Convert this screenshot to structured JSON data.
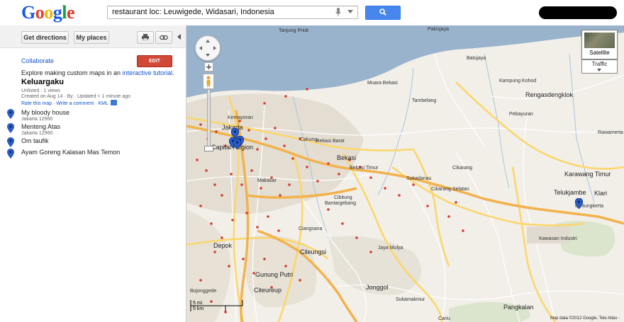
{
  "header": {
    "logo": [
      "G",
      "o",
      "o",
      "g",
      "l",
      "e"
    ],
    "logo_colors": [
      "#1a5ae6",
      "#e33b2f",
      "#f2b600",
      "#1a5ae6",
      "#139c44",
      "#e33b2f"
    ],
    "search_value": "restaurant loc: Leuwigede, Widasari, Indonesia",
    "search_icon": "magnifier-icon"
  },
  "panel": {
    "get_directions": "Get directions",
    "my_places": "My places",
    "collaborate": "Collaborate",
    "edit": "EDIT",
    "explore_prefix": "Explore making custom maps in an ",
    "explore_link": "interactive tutorial",
    "explore_suffix": ".",
    "title": "Keluargaku",
    "meta_line1": "Unlisted · 1 views",
    "meta_line2_prefix": "Created on Aug 14 · By ",
    "meta_line2_suffix": " · Updated < 1 minute ago",
    "rate": "Rate this map",
    "write_comment": "Write a comment",
    "kml": "KML",
    "places": [
      {
        "name": "My bloody house",
        "address": "Jakarta 12960"
      },
      {
        "name": "Menteng Atas",
        "address": "Jakarta 12960"
      },
      {
        "name": "Om taufik",
        "address": ""
      },
      {
        "name": "Ayam Goreng Kalasan Mas Temon",
        "address": ""
      }
    ]
  },
  "map": {
    "controls": {
      "satellite": "Satellite",
      "traffic": "Traffic",
      "zoom_plus": "+"
    },
    "scale_mi": "5 mi",
    "scale_km": "5 km",
    "copyright": "Map data ©2012 Google, Tele Atlas -",
    "colors": {
      "sea": "#99b3cc",
      "land": "#f2efe9",
      "toll": "#f2b24c",
      "road": "#fbd66a",
      "urban": "#e7dfd4",
      "marker": "#2a5cc7"
    },
    "labels": [
      {
        "t": "Pakisjaya"
      },
      {
        "t": "Tanjung Priok"
      },
      {
        "t": "Batujaya"
      },
      {
        "t": "Muara Bekasi"
      },
      {
        "t": "Kampung Kohod"
      },
      {
        "t": "Rengasdengklok"
      },
      {
        "t": "Tambelang"
      },
      {
        "t": "Pebayuran"
      },
      {
        "t": "Kemayoran"
      },
      {
        "t": "Jakarta"
      },
      {
        "t": "Capital Region"
      },
      {
        "t": "Cakung"
      },
      {
        "t": "Bekasi Barat"
      },
      {
        "t": "Bekasi"
      },
      {
        "t": "Bekasi Timur"
      },
      {
        "t": "Cikarang"
      },
      {
        "t": "Karawang Timur"
      },
      {
        "t": "Telukjambe"
      },
      {
        "t": "Klari"
      },
      {
        "t": "Gintungkerta"
      },
      {
        "t": "Sukadanau"
      },
      {
        "t": "Cibitung"
      },
      {
        "t": "Cikarang Selatan"
      },
      {
        "t": "Makasar"
      },
      {
        "t": "Bantargebang"
      },
      {
        "t": "Ciangsana"
      },
      {
        "t": "Depok"
      },
      {
        "t": "Cileungsi"
      },
      {
        "t": "Gunung Putri"
      },
      {
        "t": "Citeureup"
      },
      {
        "t": "Jonggol"
      },
      {
        "t": "Bojonggede"
      },
      {
        "t": "Pangkalan"
      },
      {
        "t": "Cariu"
      },
      {
        "t": "Rawamerta"
      },
      {
        "t": "Jaya Mulya"
      },
      {
        "t": "Sukamakmur"
      },
      {
        "t": "Kawasan Industri"
      }
    ],
    "markers": [
      {
        "name": "marker-my-bloody-house"
      },
      {
        "name": "marker-menteng-atas"
      },
      {
        "name": "marker-om-taufik"
      },
      {
        "name": "marker-ayam-goreng"
      },
      {
        "name": "marker-telukjambe"
      }
    ]
  }
}
